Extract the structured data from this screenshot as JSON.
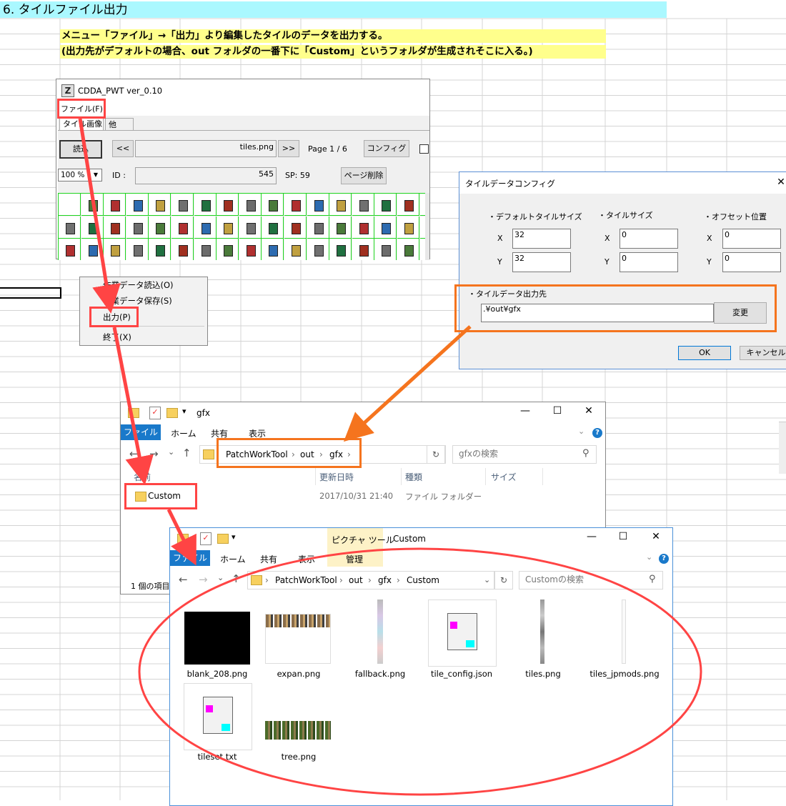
{
  "section_title": "6. タイルファイル出力",
  "notes": [
    "メニュー「ファイル」→「出力」より編集したタイルのデータを出力する。",
    "(出力先がデフォルトの場合、out フォルダの一番下に「Custom」というフォルダが生成されそこに入る。)"
  ],
  "app": {
    "title": "CDDA_PWT  ver_0.10",
    "menu_file": "ファイル(F)",
    "tabs": [
      "タイル画像",
      "他"
    ],
    "load_button": "読込",
    "prev_button": "<<",
    "next_button": ">>",
    "file_field": "tiles.png",
    "page_label": "Page 1 / 6",
    "config_button": "コンフィグ",
    "zoom": "100 %",
    "id_label": "ID :",
    "id_value": "545",
    "sp_label": "SP: 59",
    "delete_page_button": "ページ削除"
  },
  "file_menu": {
    "items": [
      "作業データ読込(O)",
      "作業データ保存(S)",
      "出力(P)",
      "終了(X)"
    ]
  },
  "config_dialog": {
    "title": "タイルデータコンフィグ",
    "default_size_label": "・デフォルトタイルサイズ",
    "tile_size_label": "・タイルサイズ",
    "offset_label": "・オフセット位置",
    "x_label": "X",
    "y_label": "Y",
    "default_x": "32",
    "default_y": "32",
    "tile_x": "0",
    "tile_y": "0",
    "offset_x": "0",
    "offset_y": "0",
    "output_label": "・タイルデータ出力先",
    "output_path": ".¥out¥gfx",
    "change_button": "変更",
    "ok_button": "OK",
    "cancel_button": "キャンセル"
  },
  "explorer_gfx": {
    "title": "gfx",
    "tabs": [
      "ファイル",
      "ホーム",
      "共有",
      "表示"
    ],
    "path": [
      "PatchWorkTool",
      "out",
      "gfx"
    ],
    "search_placeholder": "gfxの検索",
    "columns": [
      "名前",
      "更新日時",
      "種類",
      "サイズ"
    ],
    "row": {
      "name": "Custom",
      "date": "2017/10/31 21:40",
      "type": "ファイル フォルダー"
    },
    "status": "1 個の項目"
  },
  "explorer_custom": {
    "title": "Custom",
    "context_tab": "ピクチャ ツール",
    "manage_tab": "管理",
    "tabs": [
      "ファイル",
      "ホーム",
      "共有",
      "表示"
    ],
    "path": [
      "PatchWorkTool",
      "out",
      "gfx",
      "Custom"
    ],
    "search_placeholder": "Customの検索",
    "files": [
      "blank_208.png",
      "expan.png",
      "fallback.png",
      "tile_config.json",
      "tiles.png",
      "tiles_jpmods.png",
      "tileset.txt",
      "tree.png"
    ]
  },
  "colors": {
    "title_band": "#aaf8ff",
    "note_band": "#ffff8c",
    "highlight_red": "#ff4444",
    "highlight_orange": "#f5741e",
    "explorer_blue": "#1979ca",
    "tile_grid": "#1ed41e"
  }
}
